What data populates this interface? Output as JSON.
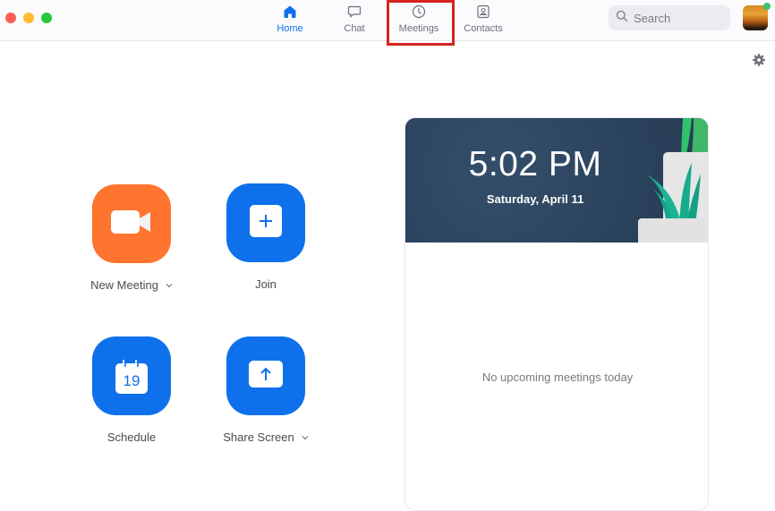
{
  "window": {
    "traffic_lights": [
      "close",
      "minimize",
      "zoom"
    ]
  },
  "nav": {
    "tabs": [
      {
        "label": "Home",
        "icon": "home-icon",
        "active": true
      },
      {
        "label": "Chat",
        "icon": "chat-bubble-icon",
        "active": false
      },
      {
        "label": "Meetings",
        "icon": "clock-icon",
        "active": false,
        "highlighted": true
      },
      {
        "label": "Contacts",
        "icon": "contact-card-icon",
        "active": false
      }
    ]
  },
  "search": {
    "placeholder": "Search"
  },
  "profile": {
    "status": "online",
    "status_color": "#39c46e"
  },
  "actions": [
    {
      "label": "New Meeting",
      "icon": "video-camera-icon",
      "has_dropdown": true,
      "color": "#ff742e"
    },
    {
      "label": "Join",
      "icon": "plus-icon",
      "has_dropdown": false,
      "color": "#0e71eb"
    },
    {
      "label": "Schedule",
      "icon": "calendar-icon",
      "calendar_day": "19",
      "has_dropdown": false,
      "color": "#0e71eb"
    },
    {
      "label": "Share Screen",
      "icon": "share-up-arrow-icon",
      "has_dropdown": true,
      "color": "#0e71eb"
    }
  ],
  "clock_card": {
    "time": "5:02 PM",
    "date": "Saturday, April 11",
    "empty_message": "No upcoming meetings today"
  },
  "colors": {
    "accent": "#0e71eb",
    "highlight_box": "#d6231f"
  }
}
